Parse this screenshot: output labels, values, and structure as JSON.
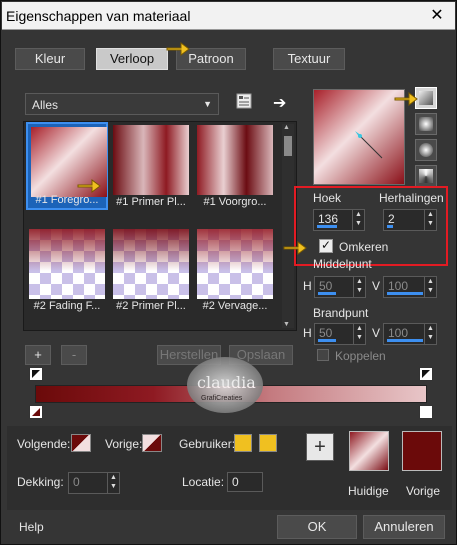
{
  "window": {
    "title": "Eigenschappen van materiaal",
    "close_glyph": "✕"
  },
  "tabs": [
    {
      "label": "Kleur"
    },
    {
      "label": "Verloop"
    },
    {
      "label": "Patroon"
    },
    {
      "label": "Textuur"
    }
  ],
  "library": {
    "dropdown_value": "Alles",
    "thumbnails": [
      {
        "label": "#1 Foregro..."
      },
      {
        "label": "#1 Primer Pl..."
      },
      {
        "label": "#1 Voorgro..."
      },
      {
        "label": "#2 Fading F..."
      },
      {
        "label": "#2 Primer Pl..."
      },
      {
        "label": "#2 Vervage..."
      }
    ],
    "add_label": "+",
    "remove_label": "-",
    "save_label": "Herstellen",
    "delete_label": "Opslaan"
  },
  "gradient": {
    "angle_label": "Hoek",
    "angle_value": "136",
    "repeats_label": "Herhalingen",
    "repeats_value": "2",
    "invert_label": "Omkeren",
    "invert_checked": true,
    "midpoint_label": "Middelpunt",
    "h_label": "H",
    "v_label": "V",
    "mid_h": "50",
    "mid_v": "100",
    "focal_label": "Brandpunt",
    "focal_h": "50",
    "focal_v": "100",
    "link_label": "Koppelen"
  },
  "bottom": {
    "volgende_label": "Volgende:",
    "vorige_label": "Vorige:",
    "gebruiker_label": "Gebruiker:",
    "dekking_label": "Dekking:",
    "dekking_value": "0",
    "locatie_label": "Locatie:",
    "locatie_value": "0",
    "huidige_label": "Huidige",
    "vorige2_label": "Vorige",
    "add_label": "+"
  },
  "footer": {
    "help": "Help",
    "ok": "OK",
    "cancel": "Annuleren"
  },
  "watermark": {
    "text": "claudia",
    "sub": "GrafiCreaties"
  },
  "colors": {
    "accent": "#3d8ff0",
    "highlight": "#e31b23",
    "maroon": "#6b0a0a",
    "gold": "#f0c020"
  }
}
